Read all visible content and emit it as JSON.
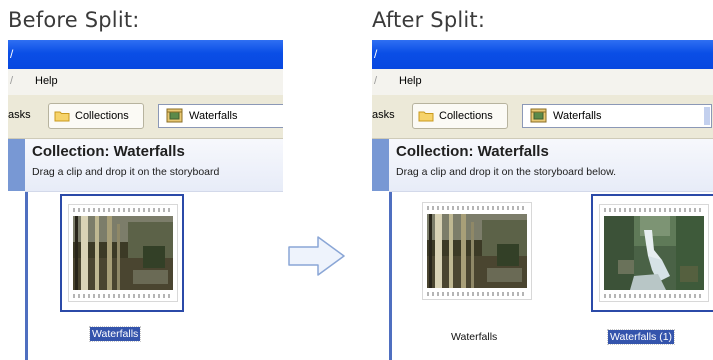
{
  "captions": {
    "before": "Before Split:",
    "after": "After Split:"
  },
  "window": {
    "menu_help": "Help",
    "tasks_tab": "asks",
    "collections_tab": "Collections",
    "collection_combo_value": "Waterfalls",
    "header_title": "Collection: Waterfalls",
    "before_instruction": "Drag a clip and drop it on the storyboard",
    "after_instruction": "Drag a clip and drop it on the storyboard below."
  },
  "before_clips": [
    {
      "label": "Waterfalls",
      "selected": true,
      "thumbnail": "forest-scene"
    }
  ],
  "after_clips": [
    {
      "label": "Waterfalls",
      "selected": false,
      "thumbnail": "forest-scene"
    },
    {
      "label": "Waterfalls (1)",
      "selected": true,
      "thumbnail": "waterfall-scene"
    }
  ],
  "colors": {
    "title_bar": "#0a4ee6",
    "selection": "#3454ac",
    "arrow_fill": "#eef3fc",
    "arrow_stroke": "#8aa6d6"
  },
  "icons": {
    "transition_arrow": "right-arrow-icon",
    "collections_tab_icon": "folder-icon",
    "combo_icon": "collection-icon"
  }
}
